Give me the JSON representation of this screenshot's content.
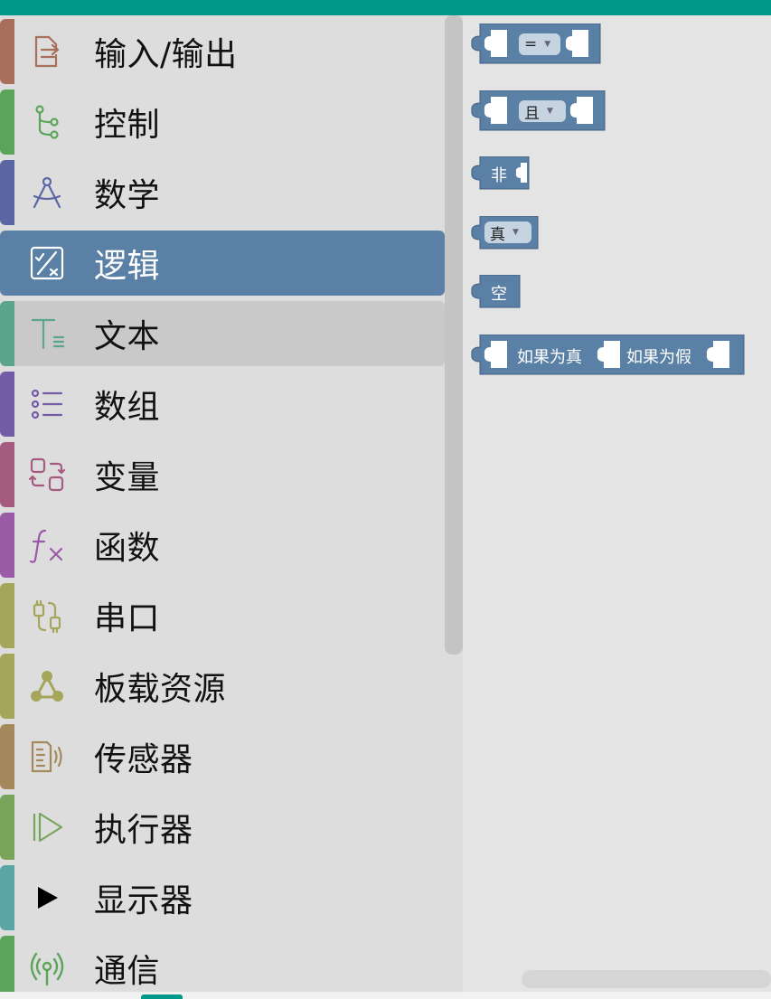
{
  "categories": [
    {
      "label": "输入/输出",
      "color": "#a8705a",
      "icon": "io-icon"
    },
    {
      "label": "控制",
      "color": "#5ba55b",
      "icon": "control-flow-icon"
    },
    {
      "label": "数学",
      "color": "#5b67a5",
      "icon": "compass-icon"
    },
    {
      "label": "逻辑",
      "color": "#5b80a5",
      "icon": "logic-icon"
    },
    {
      "label": "文本",
      "color": "#5ba58c",
      "icon": "text-icon"
    },
    {
      "label": "数组",
      "color": "#745ba5",
      "icon": "list-icon"
    },
    {
      "label": "变量",
      "color": "#a55b80",
      "icon": "variable-icon"
    },
    {
      "label": "函数",
      "color": "#995ba5",
      "icon": "function-icon"
    },
    {
      "label": "串口",
      "color": "#a5a55b",
      "icon": "serial-plug-icon"
    },
    {
      "label": "板载资源",
      "color": "#a5a55b",
      "icon": "board-resource-icon"
    },
    {
      "label": "传感器",
      "color": "#a5885b",
      "icon": "sensor-icon"
    },
    {
      "label": "执行器",
      "color": "#78a55b",
      "icon": "actuator-icon"
    },
    {
      "label": "显示器",
      "color": "#5ba5a5",
      "icon": "play-icon"
    },
    {
      "label": "通信",
      "color": "#5ba55b",
      "icon": "broadcast-icon"
    }
  ],
  "selected_category": "逻辑",
  "hovered_category": "文本",
  "blocks": {
    "compare": {
      "op": "=",
      "color": "#5b80a5"
    },
    "logic_op": {
      "op": "且"
    },
    "negate": {
      "label": "非"
    },
    "boolean": {
      "value": "真"
    },
    "null": {
      "label": "空"
    },
    "ternary": {
      "if_true": "如果为真",
      "if_false": "如果为假"
    }
  }
}
